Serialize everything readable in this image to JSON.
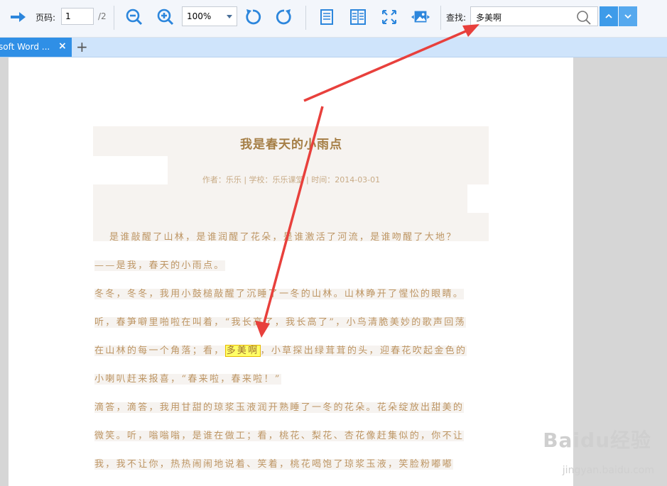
{
  "toolbar": {
    "page_label": "页码:",
    "page_value": "1",
    "page_total": "/2",
    "zoom_value": "100%",
    "search_label": "查找:",
    "search_value": "多美啊",
    "icons": [
      "arrow-right-icon",
      "zoom-out-icon",
      "zoom-in-icon",
      "rotate-left-icon",
      "rotate-right-icon",
      "single-page-icon",
      "double-page-icon",
      "fullscreen-icon",
      "image-icon",
      "search-icon",
      "chevron-up-icon",
      "chevron-down-icon"
    ],
    "accent": "#3e9be9"
  },
  "tabs": {
    "items": [
      {
        "label": "soft Word ..."
      }
    ],
    "close_symbol": "×",
    "add_symbol": "+"
  },
  "document": {
    "title": "我是春天的小雨点",
    "meta": "作者：乐乐 | 学校：乐乐课堂 | 时间：2014-03-01",
    "lines": [
      "是谁敲醒了山林，是谁润醒了花朵，是谁激活了河流，是谁吻醒了大地？",
      "——是我，春天的小雨点。",
      "冬冬，冬冬，我用小鼓槌敲醒了沉睡了一冬的山林。山林睁开了惺忪的眼睛。",
      "听，春笋噼里啪啦在叫着，“我长高了，我长高了”，小鸟清脆美妙的歌声回荡",
      "在山林的每一个角落；看，",
      "多美啊",
      "，小草探出绿茸茸的头，迎春花吹起金色的",
      "小喇叭赶来报喜，“春来啦，春来啦！”",
      "滴答，滴答，我用甘甜的琼浆玉液润开熟睡了一冬的花朵。花朵绽放出甜美的",
      "微笑。听，嗡嗡嗡，是谁在做工；看，桃花、梨花、杏花像赶集似的，你不让",
      "我，我不让你，热热闹闹地说着、笑着，桃花喝饱了琼浆玉液，笑脸粉嘟嘟"
    ],
    "text_color": "#bd9563",
    "highlight_color": "#ffff66"
  },
  "watermark": {
    "brand": "Baidu经验",
    "url": "jingyan.baidu.com"
  }
}
